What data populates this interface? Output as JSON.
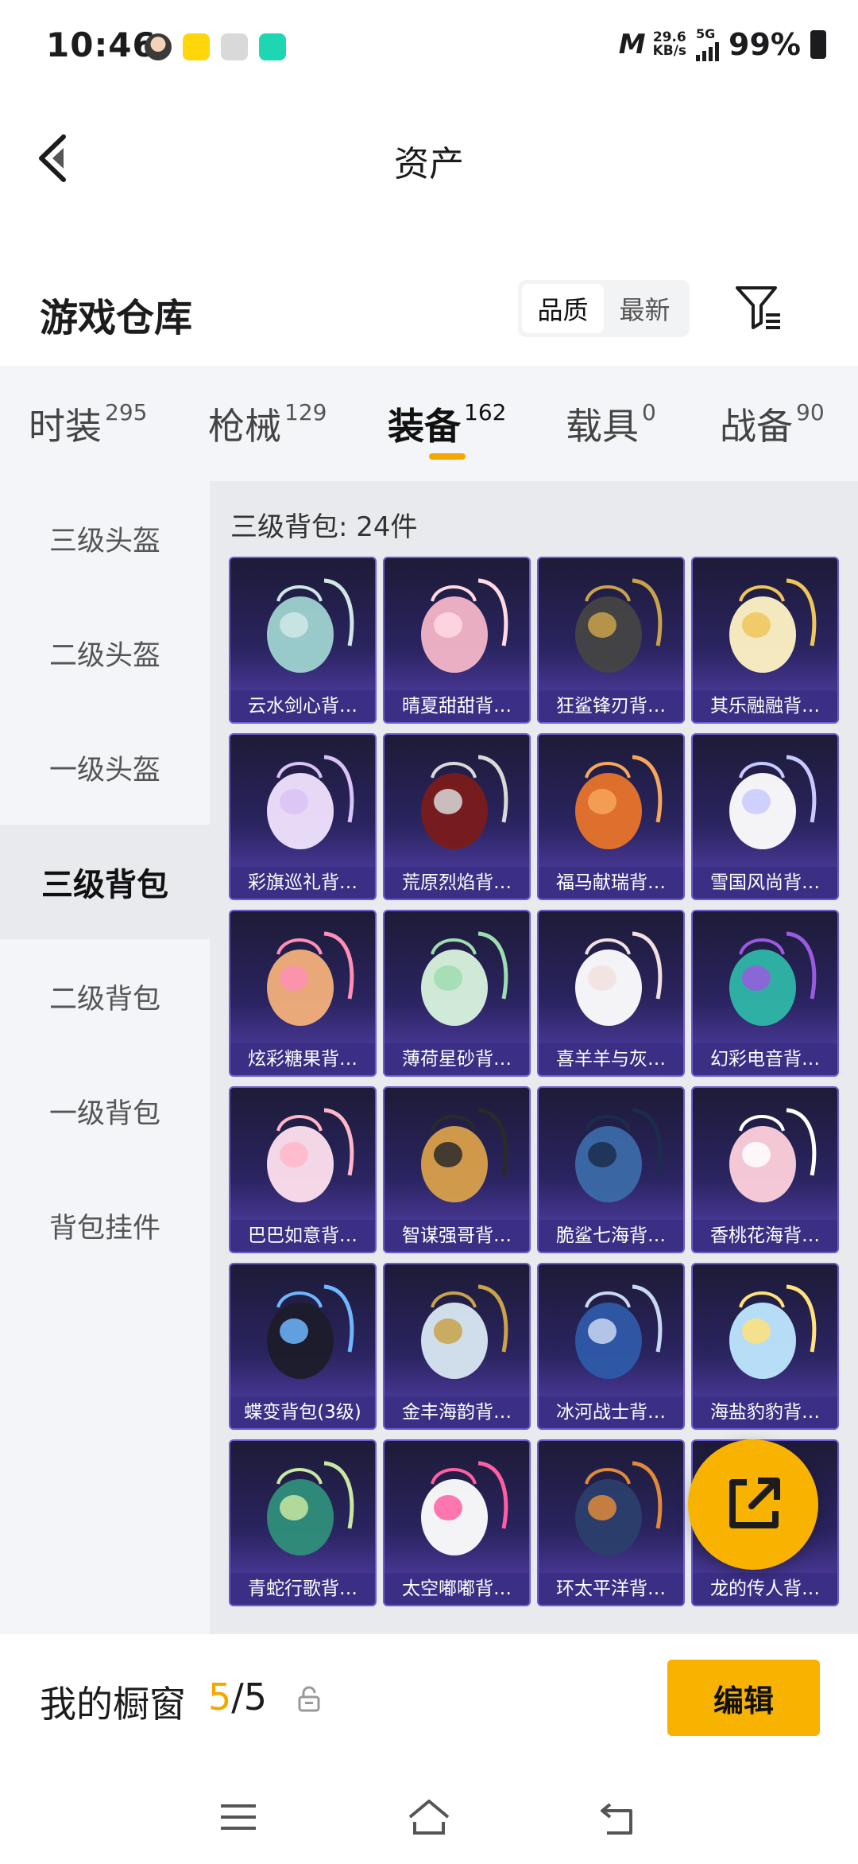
{
  "status_bar": {
    "time": "10:46",
    "net_speed_top": "29.6",
    "net_speed_bottom": "KB/s",
    "network": "5G",
    "battery": "99%"
  },
  "header": {
    "title": "资产",
    "back_icon": "chevron-left-icon"
  },
  "warehouse": {
    "title": "游戏仓库",
    "sort_options": [
      "品质",
      "最新"
    ],
    "sort_active": "品质",
    "filter_icon": "filter-list-icon"
  },
  "tabs": [
    {
      "label": "时装",
      "count": "295"
    },
    {
      "label": "枪械",
      "count": "129"
    },
    {
      "label": "装备",
      "count": "162"
    },
    {
      "label": "载具",
      "count": "0"
    },
    {
      "label": "战备",
      "count": "90"
    }
  ],
  "active_tab": "装备",
  "sidebar": {
    "items": [
      "三级头盔",
      "二级头盔",
      "一级头盔",
      "三级背包",
      "二级背包",
      "一级背包",
      "背包挂件"
    ],
    "active": "三级背包"
  },
  "content": {
    "heading": "三级背包: 24件",
    "items": [
      {
        "label": "云水剑心背…"
      },
      {
        "label": "晴夏甜甜背…"
      },
      {
        "label": "狂鲨锋刃背…"
      },
      {
        "label": "其乐融融背…"
      },
      {
        "label": "彩旗巡礼背…"
      },
      {
        "label": "荒原烈焰背…"
      },
      {
        "label": "福马献瑞背…"
      },
      {
        "label": "雪国风尚背…"
      },
      {
        "label": "炫彩糖果背…"
      },
      {
        "label": "薄荷星砂背…"
      },
      {
        "label": "喜羊羊与灰…"
      },
      {
        "label": "幻彩电音背…"
      },
      {
        "label": "巴巴如意背…"
      },
      {
        "label": "智谋强哥背…"
      },
      {
        "label": "脆鲨七海背…"
      },
      {
        "label": "香桃花海背…"
      },
      {
        "label": "蝶变背包(3级)"
      },
      {
        "label": "金丰海韵背…"
      },
      {
        "label": "冰河战士背…"
      },
      {
        "label": "海盐豹豹背…"
      },
      {
        "label": "青蛇行歌背…"
      },
      {
        "label": "太空嘟嘟背…"
      },
      {
        "label": "环太平洋背…"
      },
      {
        "label": "龙的传人背…"
      }
    ]
  },
  "showcase": {
    "label": "我的橱窗",
    "current": "5",
    "separator": "/",
    "total": "5",
    "edit_label": "编辑"
  },
  "colors": {
    "accent": "#f8b200",
    "card_top": "#1d1b37",
    "card_bottom": "#5a43b4",
    "card_label_bg": "#3a2f85"
  }
}
